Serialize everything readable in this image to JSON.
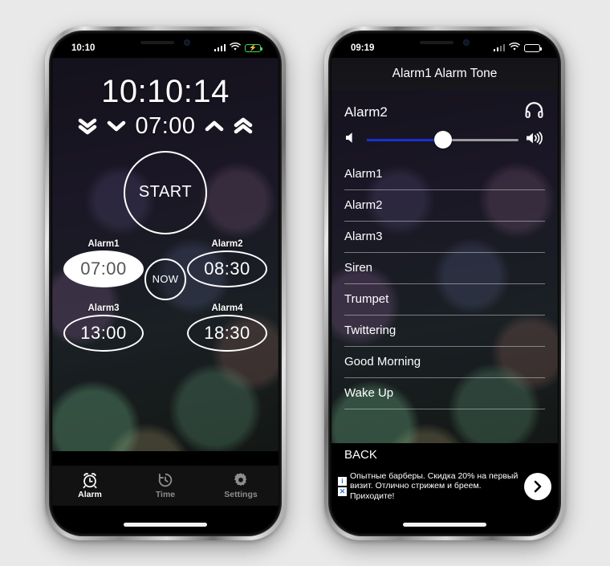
{
  "left_phone": {
    "status_bar": {
      "time": "10:10",
      "signal": "signal-bars",
      "wifi": "wifi-icon",
      "battery": "battery-charging-icon"
    },
    "app": {
      "current_time": "10:10:14",
      "set_time": "07:00",
      "controls": {
        "double_down": "chevron-double-down",
        "single_down": "chevron-down",
        "single_up": "chevron-up",
        "double_up": "chevron-double-up"
      },
      "start_label": "START",
      "now_label": "NOW",
      "alarms": [
        {
          "label": "Alarm1",
          "time": "07:00",
          "active": true
        },
        {
          "label": "Alarm2",
          "time": "08:30",
          "active": false
        },
        {
          "label": "Alarm3",
          "time": "13:00",
          "active": false
        },
        {
          "label": "Alarm4",
          "time": "18:30",
          "active": false
        }
      ],
      "tabs": [
        {
          "label": "Alarm",
          "icon": "alarm-clock-icon",
          "active": true
        },
        {
          "label": "Time",
          "icon": "clock-history-icon",
          "active": false
        },
        {
          "label": "Settings",
          "icon": "gear-icon",
          "active": false
        }
      ]
    }
  },
  "right_phone": {
    "status_bar": {
      "time": "09:19",
      "signal": "signal-bars",
      "wifi": "wifi-icon",
      "battery": "battery-icon"
    },
    "app": {
      "nav_title": "Alarm1 Alarm Tone",
      "selected_tone": "Alarm2",
      "headphone_icon": "headphones-icon",
      "volume": {
        "value_percent": 50,
        "min_icon": "volume-low-icon",
        "max_icon": "volume-high-icon",
        "track_color": "#1731d6"
      },
      "tones": [
        {
          "label": "Alarm1"
        },
        {
          "label": "Alarm2"
        },
        {
          "label": "Alarm3"
        },
        {
          "label": "Siren"
        },
        {
          "label": "Trumpet"
        },
        {
          "label": "Twittering"
        },
        {
          "label": "Good Morning"
        },
        {
          "label": "Wake Up"
        }
      ],
      "back_label": "BACK",
      "ad": {
        "text": "Опытные барберы. Скидка 20% на первый визит. Отлично стрижем и бреем. Приходите!",
        "info_icon": "i",
        "close_icon": "✕",
        "cta_icon": "chevron-right-icon"
      }
    }
  }
}
